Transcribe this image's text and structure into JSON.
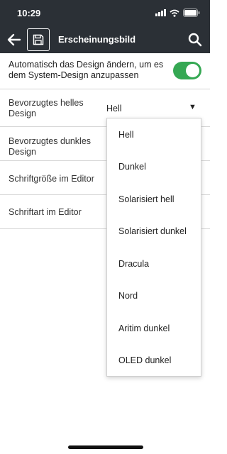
{
  "status_bar": {
    "time": "10:29",
    "icons": [
      "signal-icon",
      "wifi-icon",
      "battery-icon"
    ]
  },
  "app_bar": {
    "title": "Erscheinungsbild",
    "background": "#2b3036",
    "icons": [
      "back-arrow-icon",
      "save-icon",
      "search-icon"
    ]
  },
  "settings": {
    "auto_theme": {
      "label": "Automatisch das Design ändern, um es dem System-Design anzupassen",
      "enabled": true,
      "toggle_color": "#35a853"
    },
    "preferred_light": {
      "label": "Bevorzugtes helles Design",
      "value": "Hell"
    },
    "preferred_dark": {
      "label": "Bevorzugtes dunkles Design"
    },
    "editor_font_size": {
      "label": "Schriftgröße im Editor"
    },
    "editor_font": {
      "label": "Schriftart im Editor"
    }
  },
  "dropdown": {
    "options": [
      "Hell",
      "Dunkel",
      "Solarisiert hell",
      "Solarisiert dunkel",
      "Dracula",
      "Nord",
      "Aritim dunkel",
      "OLED dunkel"
    ]
  }
}
